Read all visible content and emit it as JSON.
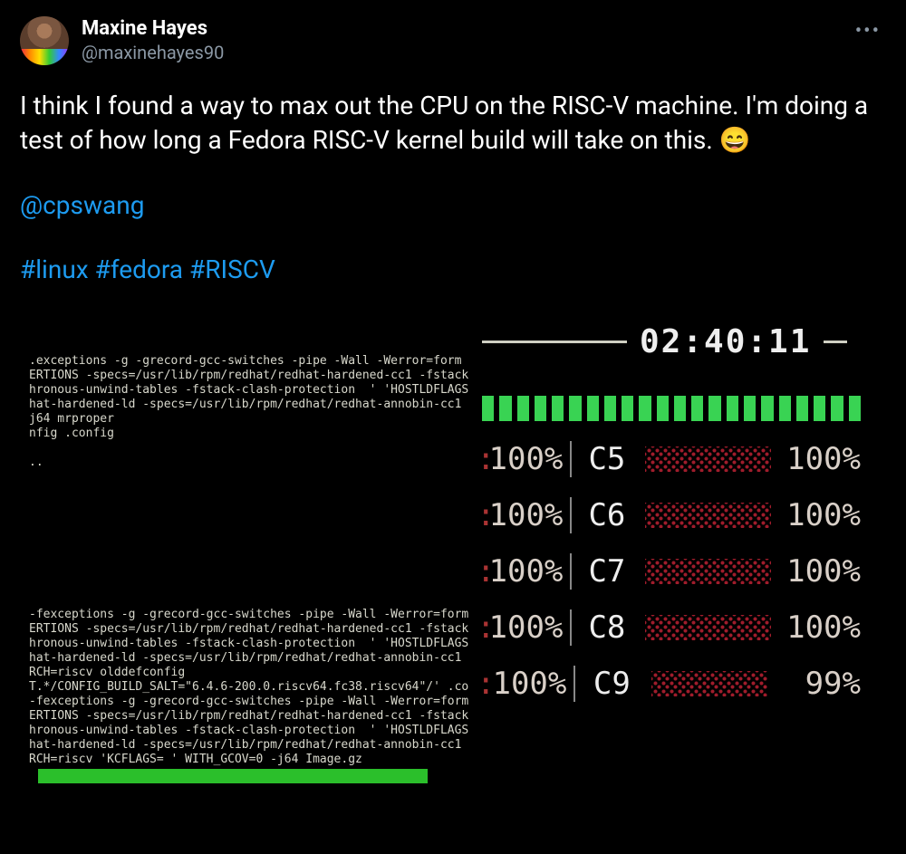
{
  "author": {
    "display_name": "Maxine Hayes",
    "handle": "@maxinehayes90"
  },
  "more_label": "•••",
  "body": {
    "text_1": "I think I found a way to max out the CPU on the RISC-V machine. I'm doing a test of how long a Fedora RISC-V kernel build will take on this. ",
    "emoji": "😄",
    "mention": "@cpswang",
    "hashtags": [
      "#linux",
      "#fedora",
      "#RISCV"
    ]
  },
  "terminal": {
    "clock": "02:40:11",
    "left_block_1": ".exceptions -g -grecord-gcc-switches -pipe -Wall -Werror=form\nERTIONS -specs=/usr/lib/rpm/redhat/redhat-hardened-cc1 -fstack\nhronous-unwind-tables -fstack-clash-protection  ' 'HOSTLDFLAGS\nhat-hardened-ld -specs=/usr/lib/rpm/redhat/redhat-annobin-cc1\nj64 mrproper\nnfig .config\n\n..",
    "left_block_2": "-fexceptions -g -grecord-gcc-switches -pipe -Wall -Werror=form\nERTIONS -specs=/usr/lib/rpm/redhat/redhat-hardened-cc1 -fstack\nhronous-unwind-tables -fstack-clash-protection  ' 'HOSTLDFLAGS\nhat-hardened-ld -specs=/usr/lib/rpm/redhat/redhat-annobin-cc1\nRCH=riscv olddefconfig\nT.*/CONFIG_BUILD_SALT=\"6.4.6-200.0.riscv64.fc38.riscv64\"/' .co\n-fexceptions -g -grecord-gcc-switches -pipe -Wall -Werror=form\nERTIONS -specs=/usr/lib/rpm/redhat/redhat-hardened-cc1 -fstack\nhronous-unwind-tables -fstack-clash-protection  ' 'HOSTLDFLAGS\nhat-hardened-ld -specs=/usr/lib/rpm/redhat/redhat-annobin-cc1\nRCH=riscv 'KCFLAGS= ' WITH_GCOV=0 -j64 Image.gz",
    "green_segments": 22,
    "cpu_rows": [
      {
        "left_pct": "100%",
        "core": "C5",
        "right_pct": "100%",
        "full": true
      },
      {
        "left_pct": "100%",
        "core": "C6",
        "right_pct": "100%",
        "full": true
      },
      {
        "left_pct": "100%",
        "core": "C7",
        "right_pct": "100%",
        "full": true
      },
      {
        "left_pct": "100%",
        "core": "C8",
        "right_pct": "100%",
        "full": true
      },
      {
        "left_pct": "100%",
        "core": "C9",
        "right_pct": "99%",
        "full": false
      }
    ]
  }
}
